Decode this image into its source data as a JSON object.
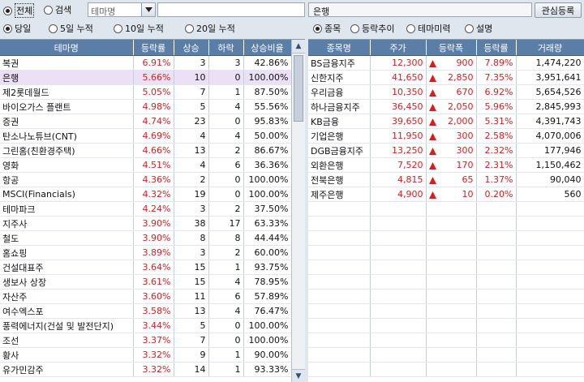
{
  "top": {
    "mode_options": [
      "전체",
      "검색"
    ],
    "theme_select_value": "테마명",
    "theme_search_value": "",
    "selected_theme": "은행",
    "register_button": "관심등록"
  },
  "period_options": [
    "당일",
    "5일 누적",
    "10일 누적",
    "20일 누적"
  ],
  "view_options": [
    "종목",
    "등락추이",
    "테마미력",
    "설명"
  ],
  "theme_table": {
    "headers": [
      "테마명",
      "등락률",
      "상승",
      "하락",
      "상승비율"
    ],
    "rows": [
      {
        "name": "복권",
        "rate": "6.91%",
        "up": "3",
        "down": "3",
        "ratio": "42.86%"
      },
      {
        "name": "은행",
        "rate": "5.66%",
        "up": "10",
        "down": "0",
        "ratio": "100.00%"
      },
      {
        "name": "제2롯데월드",
        "rate": "5.05%",
        "up": "7",
        "down": "1",
        "ratio": "87.50%"
      },
      {
        "name": "바이오가스 플랜트",
        "rate": "4.98%",
        "up": "5",
        "down": "4",
        "ratio": "55.56%"
      },
      {
        "name": "증권",
        "rate": "4.74%",
        "up": "23",
        "down": "0",
        "ratio": "95.83%"
      },
      {
        "name": "탄소나노튜브(CNT)",
        "rate": "4.69%",
        "up": "4",
        "down": "4",
        "ratio": "50.00%"
      },
      {
        "name": "그린홈(친환경주택)",
        "rate": "4.66%",
        "up": "13",
        "down": "2",
        "ratio": "86.67%"
      },
      {
        "name": "영화",
        "rate": "4.51%",
        "up": "4",
        "down": "6",
        "ratio": "36.36%"
      },
      {
        "name": "항공",
        "rate": "4.36%",
        "up": "2",
        "down": "0",
        "ratio": "100.00%"
      },
      {
        "name": "MSCI(Financials)",
        "rate": "4.32%",
        "up": "19",
        "down": "0",
        "ratio": "100.00%"
      },
      {
        "name": "테마파크",
        "rate": "4.24%",
        "up": "3",
        "down": "2",
        "ratio": "37.50%"
      },
      {
        "name": "지주사",
        "rate": "3.90%",
        "up": "38",
        "down": "17",
        "ratio": "63.33%"
      },
      {
        "name": "철도",
        "rate": "3.90%",
        "up": "8",
        "down": "8",
        "ratio": "44.44%"
      },
      {
        "name": "홈쇼핑",
        "rate": "3.89%",
        "up": "3",
        "down": "2",
        "ratio": "60.00%"
      },
      {
        "name": "건설대표주",
        "rate": "3.64%",
        "up": "15",
        "down": "1",
        "ratio": "93.75%"
      },
      {
        "name": "생보사 상장",
        "rate": "3.61%",
        "up": "15",
        "down": "4",
        "ratio": "78.95%"
      },
      {
        "name": "자산주",
        "rate": "3.60%",
        "up": "11",
        "down": "6",
        "ratio": "57.89%"
      },
      {
        "name": "여수엑스포",
        "rate": "3.58%",
        "up": "13",
        "down": "4",
        "ratio": "76.47%"
      },
      {
        "name": "풍력에너지(건설 및 발전단지)",
        "rate": "3.44%",
        "up": "5",
        "down": "0",
        "ratio": "100.00%"
      },
      {
        "name": "조선",
        "rate": "3.37%",
        "up": "7",
        "down": "0",
        "ratio": "100.00%"
      },
      {
        "name": "황사",
        "rate": "3.32%",
        "up": "9",
        "down": "1",
        "ratio": "90.00%"
      },
      {
        "name": "유가민감주",
        "rate": "3.32%",
        "up": "14",
        "down": "1",
        "ratio": "93.33%"
      }
    ]
  },
  "stock_table": {
    "headers": [
      "종목명",
      "주가",
      "등락폭",
      "등락률",
      "거래량"
    ],
    "rows": [
      {
        "name": "BS금융지주",
        "price": "12,300",
        "change": "900",
        "rate": "7.89%",
        "volume": "1,474,220"
      },
      {
        "name": "신한지주",
        "price": "41,650",
        "change": "2,850",
        "rate": "7.35%",
        "volume": "3,951,641"
      },
      {
        "name": "우리금융",
        "price": "10,350",
        "change": "670",
        "rate": "6.92%",
        "volume": "5,654,526"
      },
      {
        "name": "하나금융지주",
        "price": "36,450",
        "change": "2,050",
        "rate": "5.96%",
        "volume": "2,845,993"
      },
      {
        "name": "KB금융",
        "price": "39,650",
        "change": "2,000",
        "rate": "5.31%",
        "volume": "4,391,743"
      },
      {
        "name": "기업은행",
        "price": "11,950",
        "change": "300",
        "rate": "2.58%",
        "volume": "4,070,006"
      },
      {
        "name": "DGB금융지주",
        "price": "13,250",
        "change": "300",
        "rate": "2.32%",
        "volume": "177,946"
      },
      {
        "name": "외환은행",
        "price": "7,520",
        "change": "170",
        "rate": "2.31%",
        "volume": "1,150,462"
      },
      {
        "name": "전북은행",
        "price": "4,815",
        "change": "65",
        "rate": "1.37%",
        "volume": "90,040"
      },
      {
        "name": "제주은행",
        "price": "4,900",
        "change": "10",
        "rate": "0.20%",
        "volume": "560"
      }
    ]
  },
  "colors": {
    "header": "#5b7ea6",
    "up": "#d3201f",
    "selected_row": "#ebe0f6"
  },
  "icons": {
    "dropdown": "caret-down-icon",
    "up_arrow": "triangle-up-icon",
    "scroll_up": "scroll-up-icon",
    "scroll_down": "scroll-down-icon"
  }
}
